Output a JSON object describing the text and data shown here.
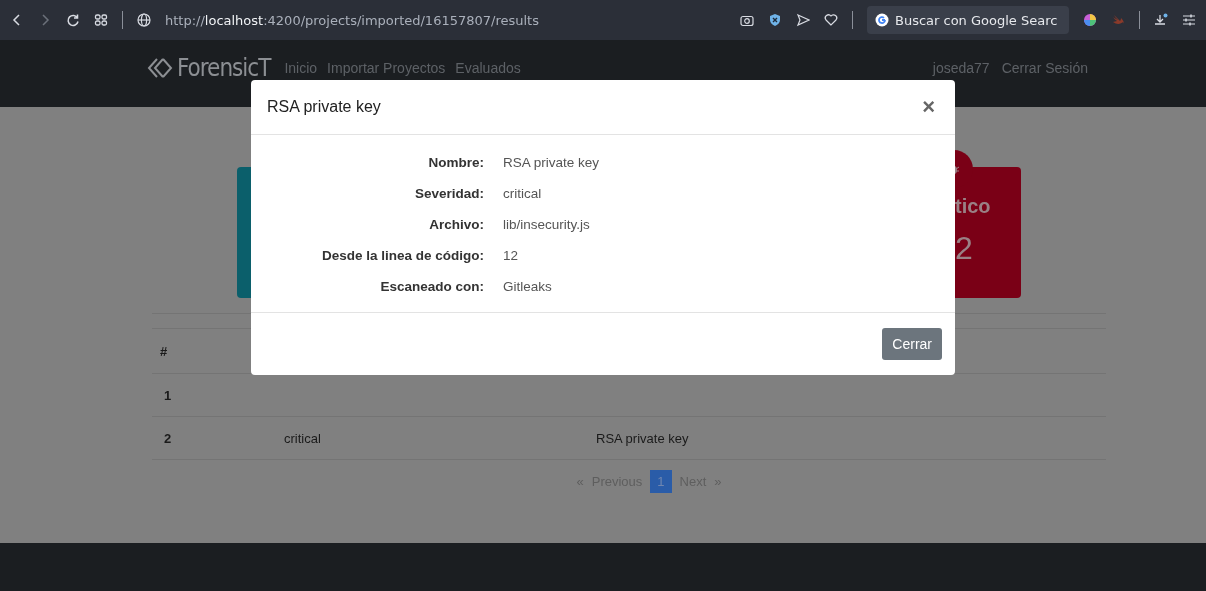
{
  "browser": {
    "url": "http://**localhost**:4200/projects/imported/16157807/results",
    "search": "Buscar con Google Searc"
  },
  "nav": {
    "brand": "ForensicT",
    "links": [
      "Inicio",
      "Importar Proyectos",
      "Evaluados"
    ],
    "user": "joseda77",
    "logout": "Cerrar Sesión"
  },
  "cards": [
    {
      "color": "#0b5f6b"
    },
    {
      "color": "#7a0016",
      "title": "tico",
      "count": "2"
    }
  ],
  "table": {
    "header": "#",
    "rows": [
      {
        "cells": [
          "1"
        ]
      },
      {
        "cells": [
          "2",
          "critical",
          "RSA private key"
        ]
      }
    ]
  },
  "pagination": {
    "prev_arrow": "«",
    "prev": "Previous",
    "pages": [
      {
        "label": "1",
        "selected": true
      }
    ],
    "next": "Next",
    "next_arrow": "»"
  },
  "modal": {
    "title": "RSA private key",
    "close": "×",
    "fields": [
      {
        "label": "Nombre:",
        "value": "RSA private key"
      },
      {
        "label": "Severidad:",
        "value": "critical"
      },
      {
        "label": "Archivo:",
        "value": "lib/insecurity.js"
      },
      {
        "label": "Desde la linea de código:",
        "value": "12"
      },
      {
        "label": "Escaneado con:",
        "value": "Gitleaks"
      }
    ],
    "button": "Cerrar"
  }
}
